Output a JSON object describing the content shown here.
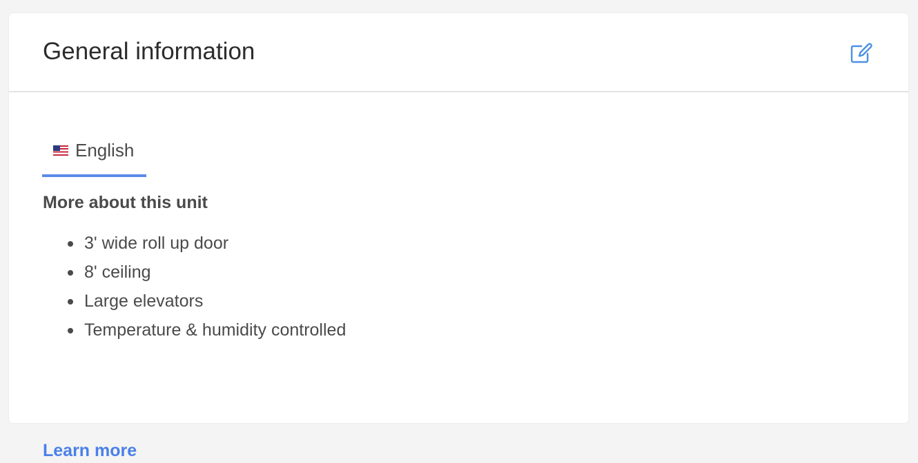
{
  "card": {
    "title": "General information",
    "edit_icon": "edit-pencil-icon"
  },
  "tabs": [
    {
      "label": "English",
      "flag_icon": "us-flag-icon",
      "active": true
    }
  ],
  "content": {
    "heading": "More about this unit",
    "features": [
      "3' wide roll up door",
      "8' ceiling",
      "Large elevators",
      "Temperature & humidity controlled"
    ],
    "link_label": "Learn more"
  },
  "colors": {
    "accent": "#4a80e8",
    "tab_underline": "#5b8be8",
    "text": "#4a4a4a",
    "title": "#2c2c2c"
  }
}
